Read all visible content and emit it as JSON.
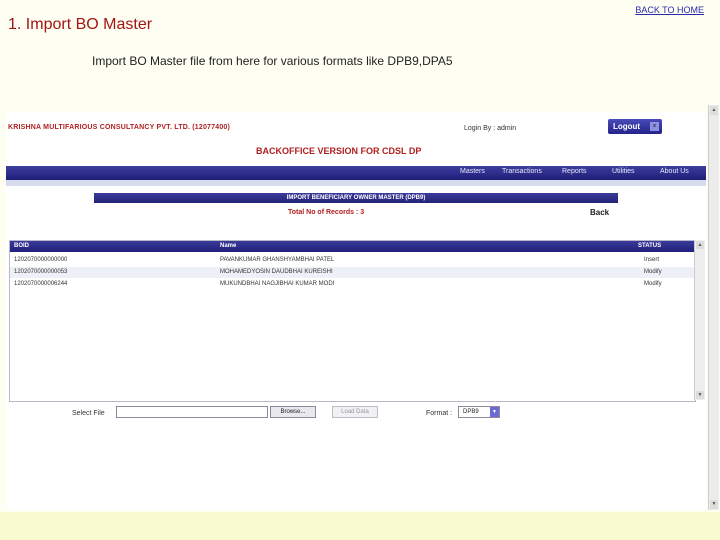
{
  "slide": {
    "back_home": "BACK TO HOME",
    "title": "1.  Import BO Master",
    "subtitle": "Import BO Master file from here for various formats like DPB9,DPA5"
  },
  "app": {
    "company": "KRISHNA MULTIFARIOUS CONSULTANCY PVT. LTD. (12077400)",
    "login": "Login By : admin",
    "logout_label": "Logout",
    "logout_icon_text": "x",
    "heading": "BACKOFFICE VERSION FOR CDSL DP",
    "nav": [
      "Masters",
      "Transactions",
      "Reports",
      "Utilities",
      "About Us"
    ],
    "import_title": "IMPORT BENEFICIARY OWNER MASTER (DPB9)",
    "total_records": "Total No of Records : 3",
    "back_label": "Back"
  },
  "grid": {
    "columns": [
      "BOID",
      "Name",
      "STATUS"
    ],
    "rows": [
      {
        "boid": "1202070000000000",
        "name": "PAVANKUMAR GHANSHYAMBHAI PATEL",
        "status": "Insert"
      },
      {
        "boid": "1202070000000053",
        "name": "MOHAMEDYOSIN DAUDBHAI KUREISHI",
        "status": "Modify"
      },
      {
        "boid": "1202070000006244",
        "name": "MUKUNDBHAI NAGJIBHAI KUMAR MODI",
        "status": "Modify"
      }
    ]
  },
  "upload": {
    "select_label": "Select File",
    "file_value": "",
    "browse_label": "Browse...",
    "load_label": "Load Data",
    "format_label": "Format :",
    "format_value": "DPB9"
  }
}
